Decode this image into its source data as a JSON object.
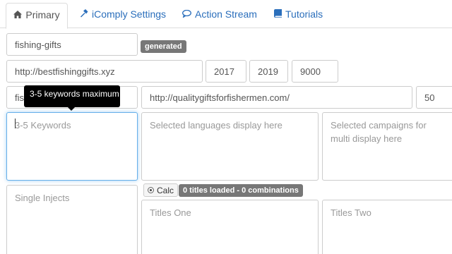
{
  "tabs": [
    {
      "label": "Primary",
      "icon": "home-icon",
      "active": true
    },
    {
      "label": "iComply Settings",
      "icon": "hammer-icon",
      "active": false
    },
    {
      "label": "Action Stream",
      "icon": "speech-bubble-icon",
      "active": false
    },
    {
      "label": "Tutorials",
      "icon": "book-icon",
      "active": false
    }
  ],
  "form": {
    "slug": "fishing-gifts",
    "slug_badge": "generated",
    "url": "http://bestfishinggifts.xyz",
    "year_start": "2017",
    "year_end": "2019",
    "number": "9000",
    "keyword_field_partial": "fis",
    "target_url": "http://qualitygiftsforfishermen.com/",
    "count": "50",
    "keywords_placeholder": "3-5 Keywords",
    "keywords_tooltip": "3-5 keywords maximum",
    "languages_placeholder": "Selected languages display here",
    "campaigns_placeholder": "Selected campaigns for multi display here",
    "single_injects_placeholder": "Single Injects",
    "calc_label": "Calc",
    "titles_status": "0 titles loaded - 0 combinations",
    "titles_one_placeholder": "Titles One",
    "titles_two_placeholder": "Titles Two"
  },
  "colors": {
    "link": "#2a6ebb",
    "focus_border": "#66afe9",
    "badge_bg": "#777777"
  }
}
